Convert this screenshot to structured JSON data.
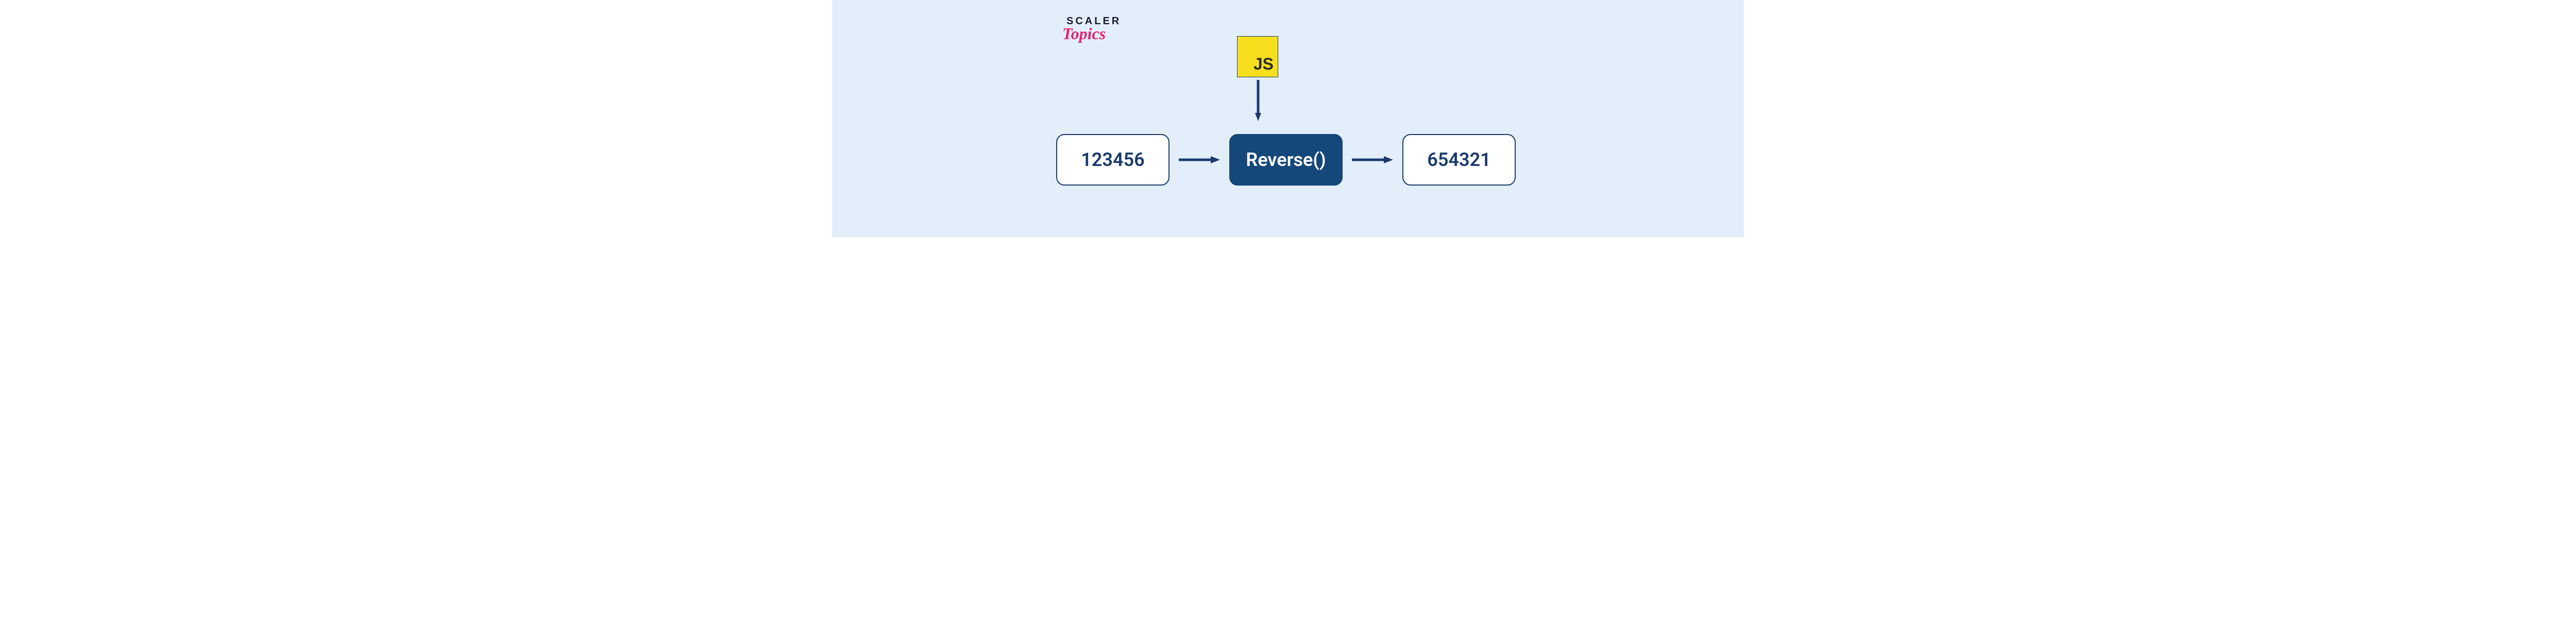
{
  "logo": {
    "line1": "SCALER",
    "line2": "Topics"
  },
  "js_badge": {
    "label": "JS"
  },
  "diagram": {
    "input_box": "123456",
    "function_box": "Reverse()",
    "output_box": "654321"
  },
  "colors": {
    "background": "#e3eefb",
    "box_border": "#1a3a6e",
    "box_text": "#1a3a6e",
    "center_box_bg": "#14477a",
    "center_box_text": "#ffffff",
    "js_bg": "#f7df1e",
    "logo_accent": "#e6226e"
  }
}
